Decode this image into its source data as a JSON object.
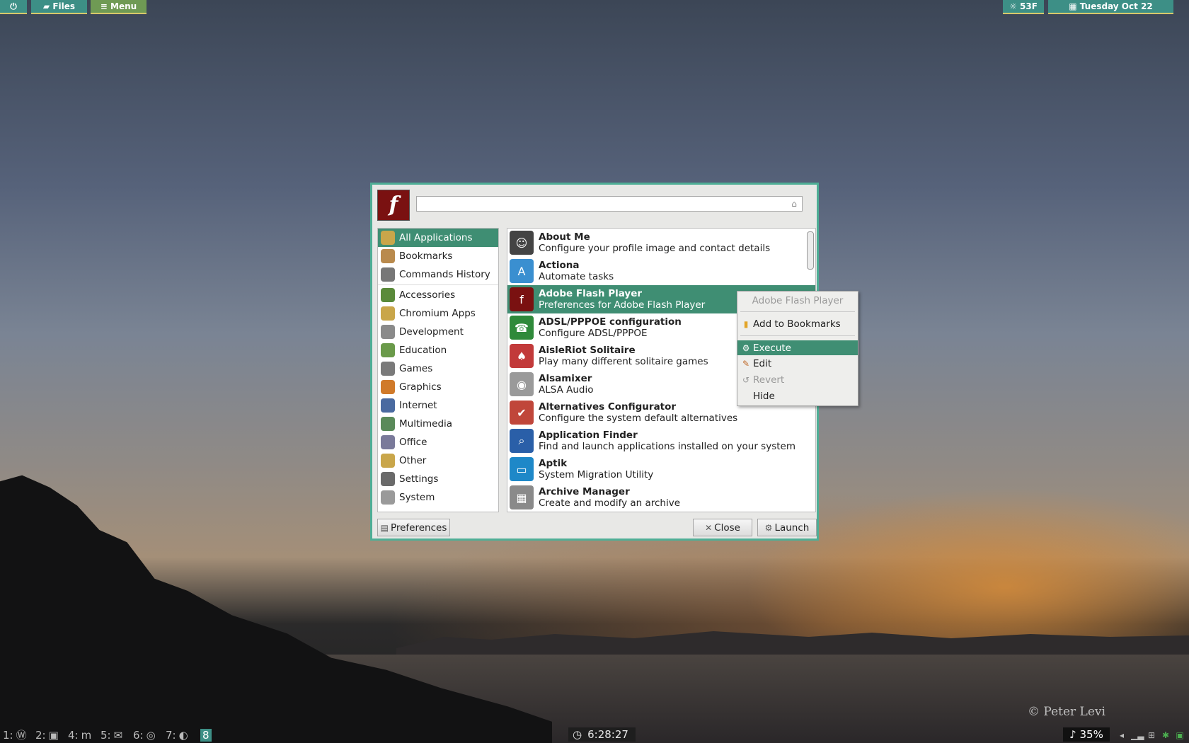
{
  "top_panel": {
    "power_icon": "power-icon",
    "files_label": "Files",
    "menu_label": "Menu",
    "weather": "53F",
    "date": "Tuesday Oct 22"
  },
  "finder": {
    "search": {
      "value": "",
      "placeholder": ""
    },
    "categories_top": [
      {
        "label": "All Applications",
        "icon": "all-apps-icon",
        "color": "#c9a64a"
      },
      {
        "label": "Bookmarks",
        "icon": "bookmark-icon",
        "color": "#b98a4d"
      },
      {
        "label": "Commands History",
        "icon": "history-icon",
        "color": "#777777"
      }
    ],
    "categories": [
      {
        "label": "Accessories",
        "icon": "accessories-icon",
        "color": "#5a8a3a"
      },
      {
        "label": "Chromium Apps",
        "icon": "chromium-apps-icon",
        "color": "#c9a64a"
      },
      {
        "label": "Development",
        "icon": "development-icon",
        "color": "#8a8a8a"
      },
      {
        "label": "Education",
        "icon": "education-icon",
        "color": "#6a9a4a"
      },
      {
        "label": "Games",
        "icon": "games-icon",
        "color": "#7a7a7a"
      },
      {
        "label": "Graphics",
        "icon": "graphics-icon",
        "color": "#d07a2a"
      },
      {
        "label": "Internet",
        "icon": "internet-icon",
        "color": "#4a6aa0"
      },
      {
        "label": "Multimedia",
        "icon": "multimedia-icon",
        "color": "#5a8a5a"
      },
      {
        "label": "Office",
        "icon": "office-icon",
        "color": "#7a7a9a"
      },
      {
        "label": "Other",
        "icon": "other-icon",
        "color": "#c9a64a"
      },
      {
        "label": "Settings",
        "icon": "settings-icon",
        "color": "#6a6a6a"
      },
      {
        "label": "System",
        "icon": "system-icon",
        "color": "#9a9a9a"
      }
    ],
    "apps": [
      {
        "name": "About Me",
        "desc": "Configure your profile image and contact details",
        "icon": "about-me-icon",
        "color": "#444444"
      },
      {
        "name": "Actiona",
        "desc": "Automate tasks",
        "icon": "actiona-icon",
        "color": "#3a8fd0"
      },
      {
        "name": "Adobe Flash Player",
        "desc": "Preferences for Adobe Flash Player",
        "icon": "flash-icon",
        "color": "#7a1111"
      },
      {
        "name": "ADSL/PPPOE configuration",
        "desc": "Configure ADSL/PPPOE",
        "icon": "adsl-icon",
        "color": "#2f8a3a"
      },
      {
        "name": "AisleRiot Solitaire",
        "desc": "Play many different solitaire games",
        "icon": "solitaire-icon",
        "color": "#c23a3a"
      },
      {
        "name": "Alsamixer",
        "desc": "ALSA Audio",
        "icon": "alsamixer-icon",
        "color": "#9a9a9a"
      },
      {
        "name": "Alternatives Configurator",
        "desc": "Configure the system default alternatives",
        "icon": "alternatives-icon",
        "color": "#c0463a"
      },
      {
        "name": "Application Finder",
        "desc": "Find and launch applications installed on your system",
        "icon": "magnifier-icon",
        "color": "#2a5fa8"
      },
      {
        "name": "Aptik",
        "desc": "System Migration Utility",
        "icon": "aptik-icon",
        "color": "#1e88c8"
      },
      {
        "name": "Archive Manager",
        "desc": "Create and modify an archive",
        "icon": "archive-icon",
        "color": "#8a8a8a"
      }
    ],
    "buttons": {
      "preferences": "Preferences",
      "close": "Close",
      "launch": "Launch"
    }
  },
  "context_menu": {
    "title": "Adobe Flash Player",
    "add_bookmark": "Add to Bookmarks",
    "execute": "Execute",
    "edit": "Edit",
    "revert": "Revert",
    "hide": "Hide"
  },
  "bottom_panel": {
    "workspaces": [
      {
        "label": "1:",
        "icon": "wordpress-icon"
      },
      {
        "label": "2:",
        "icon": "camera-icon"
      },
      {
        "label": "4:",
        "icon": "m-icon"
      },
      {
        "label": "5:",
        "icon": "mail-icon"
      },
      {
        "label": "6:",
        "icon": "chrome-icon"
      },
      {
        "label": "7:",
        "icon": "firefox-icon"
      }
    ],
    "active_workspace": "8",
    "clock": "6:28:27",
    "volume": "♪ 35%",
    "watermark": "© Peter Levi"
  }
}
